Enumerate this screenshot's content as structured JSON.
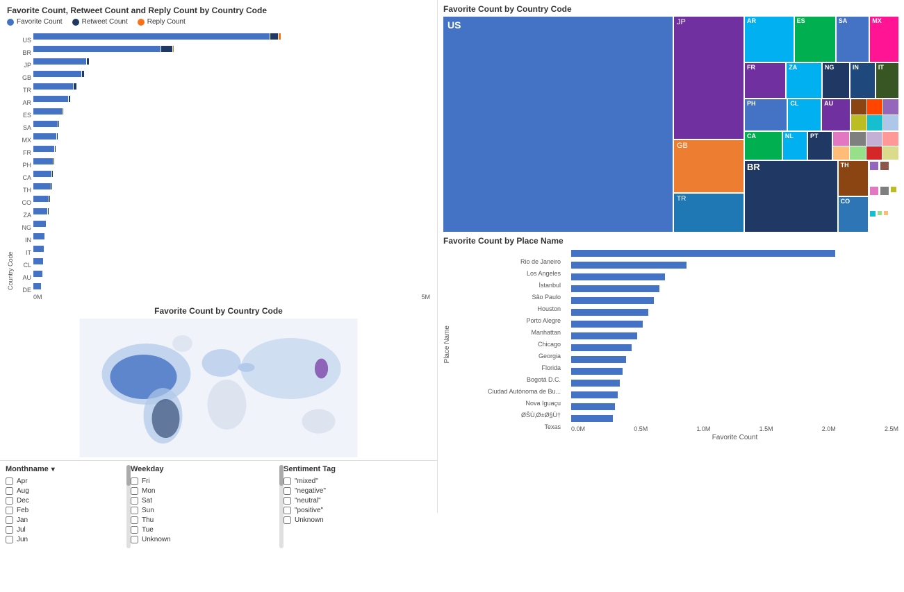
{
  "leftPanel": {
    "barChart": {
      "title": "Favorite Count, Retweet Count and Reply Count by Country Code",
      "legend": [
        {
          "label": "Favorite Count",
          "color": "#4472C4"
        },
        {
          "label": "Retweet Count",
          "color": "#203864"
        },
        {
          "label": "Reply Count",
          "color": "#F97316"
        }
      ],
      "countries": [
        "US",
        "BR",
        "JP",
        "GB",
        "TR",
        "AR",
        "ES",
        "SA",
        "MX",
        "FR",
        "PH",
        "CA",
        "TH",
        "CO",
        "ZA",
        "NG",
        "IN",
        "IT",
        "CL",
        "AU",
        "DE"
      ],
      "favBars": [
        540,
        290,
        120,
        110,
        90,
        80,
        65,
        55,
        52,
        48,
        45,
        42,
        40,
        35,
        32,
        28,
        26,
        24,
        22,
        20,
        18
      ],
      "rtBars": [
        18,
        25,
        5,
        4,
        6,
        3,
        2,
        1,
        1,
        1,
        1,
        1,
        1,
        1,
        1,
        0,
        0,
        0,
        0,
        0,
        0
      ],
      "rpBars": [
        4,
        2,
        0,
        0,
        0,
        0,
        0,
        0,
        0,
        0,
        0,
        0,
        0,
        0,
        0,
        0,
        0,
        0,
        0,
        0,
        0
      ],
      "xLabels": [
        "0M",
        "5M"
      ],
      "yAxisLabel": "Country Code"
    },
    "mapTitle": "Favorite Count by Country Code",
    "filters": {
      "monthname": {
        "label": "Monthname",
        "items": [
          "Apr",
          "Aug",
          "Dec",
          "Feb",
          "Jan",
          "Jul",
          "Jun"
        ]
      },
      "weekday": {
        "label": "Weekday",
        "items": [
          "Fri",
          "Mon",
          "Sat",
          "Sun",
          "Thu",
          "Tue",
          "Unknown"
        ]
      },
      "sentiment": {
        "label": "Sentiment Tag",
        "items": [
          "\"mixed\"",
          "\"negative\"",
          "\"neutral\"",
          "\"positive\"",
          "Unknown"
        ]
      }
    }
  },
  "rightPanel": {
    "treemap": {
      "title": "Favorite Count by Country Code",
      "cells": [
        {
          "label": "US",
          "color": "#4472C4",
          "size": "large"
        },
        {
          "label": "JP",
          "color": "#7030A0"
        },
        {
          "label": "AR",
          "color": "#00B0F0"
        },
        {
          "label": "ES",
          "color": "#00B050"
        },
        {
          "label": "SA",
          "color": "#4472C4"
        },
        {
          "label": "MX",
          "color": "#FF1493"
        },
        {
          "label": "FR",
          "color": "#7030A0"
        },
        {
          "label": "ZA",
          "color": "#00B0F0"
        },
        {
          "label": "NG",
          "color": "#203864"
        },
        {
          "label": "IN",
          "color": "#1F497D"
        },
        {
          "label": "IT",
          "color": "#375623"
        },
        {
          "label": "GB",
          "color": "#ED7D31"
        },
        {
          "label": "PH",
          "color": "#4472C4"
        },
        {
          "label": "CL",
          "color": "#00B0F0"
        },
        {
          "label": "AU",
          "color": "#7030A0"
        },
        {
          "label": "CA",
          "color": "#00B050"
        },
        {
          "label": "NL",
          "color": "#00B0F0"
        },
        {
          "label": "PT",
          "color": "#203864"
        },
        {
          "label": "BR",
          "color": "#203864",
          "size": "large"
        },
        {
          "label": "TR",
          "color": "#1F77B4"
        },
        {
          "label": "TH",
          "color": "#8B4513"
        },
        {
          "label": "CO",
          "color": "#2E75B6"
        }
      ]
    },
    "placeChart": {
      "title": "Favorite Count by Place Name",
      "yLabel": "Place Name",
      "xLabel": "Favorite Count",
      "places": [
        {
          "name": "Rio de Janeiro",
          "value": 240
        },
        {
          "name": "Los Angeles",
          "value": 105
        },
        {
          "name": "İstanbul",
          "value": 85
        },
        {
          "name": "São Paulo",
          "value": 80
        },
        {
          "name": "Houston",
          "value": 75
        },
        {
          "name": "Porto Alegre",
          "value": 70
        },
        {
          "name": "Manhattan",
          "value": 65
        },
        {
          "name": "Chicago",
          "value": 60
        },
        {
          "name": "Georgia",
          "value": 55
        },
        {
          "name": "Florida",
          "value": 50
        },
        {
          "name": "Bogotá D.C.",
          "value": 47
        },
        {
          "name": "Ciudad Autónoma de Bu...",
          "value": 44
        },
        {
          "name": "Nova Iguaçu",
          "value": 42
        },
        {
          "name": "ØŠÙ‚Ø±Ø§Ù†",
          "value": 40
        },
        {
          "name": "Texas",
          "value": 38
        }
      ],
      "xAxisLabels": [
        "0.0M",
        "0.5M",
        "1.0M",
        "1.5M",
        "2.0M",
        "2.5M"
      ]
    }
  }
}
